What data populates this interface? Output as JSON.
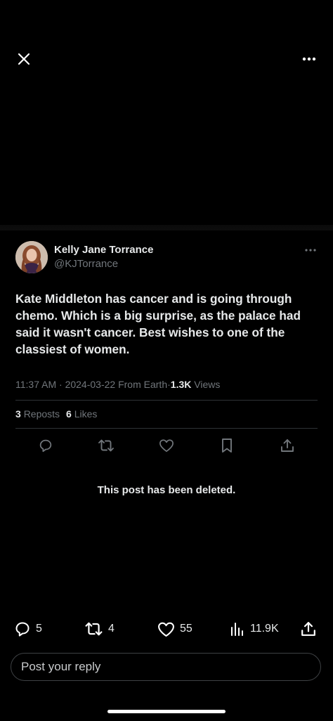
{
  "top_bar": {
    "close_icon": "close-icon",
    "more_icon": "more-horizontal-icon"
  },
  "tweet": {
    "author_name": "Kelly Jane Torrance",
    "author_handle": "@KJTorrance",
    "avatar_icon": "avatar",
    "text": "Kate Middleton has cancer and is going through\nchemo.  Which is a big surprise, as the palace had\nsaid it wasn't cancer. Best wishes to one of the\nclassiest of women.",
    "time": "11:37 AM",
    "date": "2024-03-22",
    "source": "From Earth",
    "separator": "·",
    "views_count": "1.3K",
    "views_label": "Views",
    "reposts_count": "3",
    "reposts_label": "Reposts",
    "likes_count": "6",
    "likes_label": "Likes"
  },
  "actions": [
    "reply-icon",
    "repost-icon",
    "like-icon",
    "bookmark-icon",
    "share-icon"
  ],
  "deleted_notice": "This post has been deleted.",
  "bottom_bar": {
    "replies": "5",
    "reposts": "4",
    "likes": "55",
    "views": "11.9K"
  },
  "reply_input": {
    "placeholder": "Post your reply"
  },
  "colors": {
    "background": "#000000",
    "primary_text": "#e7e9ea",
    "secondary_text": "#71767b",
    "divider": "#2f3336"
  }
}
